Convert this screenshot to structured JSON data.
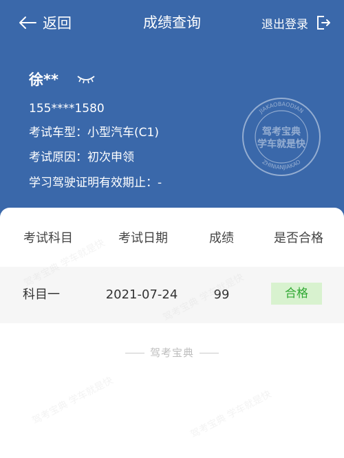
{
  "nav": {
    "back_label": "返回",
    "title": "成绩查询",
    "logout_label": "退出登录"
  },
  "user": {
    "name": "徐**",
    "phone": "155****1580",
    "vehicle_type": "考试车型：小型汽车(C1)",
    "exam_reason": "考试原因：初次申领",
    "validity": "学习驾驶证明有效期止：-"
  },
  "table": {
    "headers": [
      "考试科目",
      "考试日期",
      "成绩",
      "是否合格"
    ],
    "rows": [
      {
        "subject": "科目一",
        "date": "2021-07-24",
        "score": "99",
        "result": "合格"
      }
    ]
  },
  "seal": {
    "line1": "驾考宝典",
    "line2": "学车就是快",
    "ring_top": "JIAKAOBAODIAN",
    "ring_bottom": "ZHINIANJIAKAO"
  },
  "brand_footer": "驾考宝典",
  "watermark": "驾考宝典 学车就是快",
  "colors": {
    "header_bg": "#3a68aa",
    "pass_bg": "#d8f2cf",
    "pass_text": "#2fa832"
  }
}
